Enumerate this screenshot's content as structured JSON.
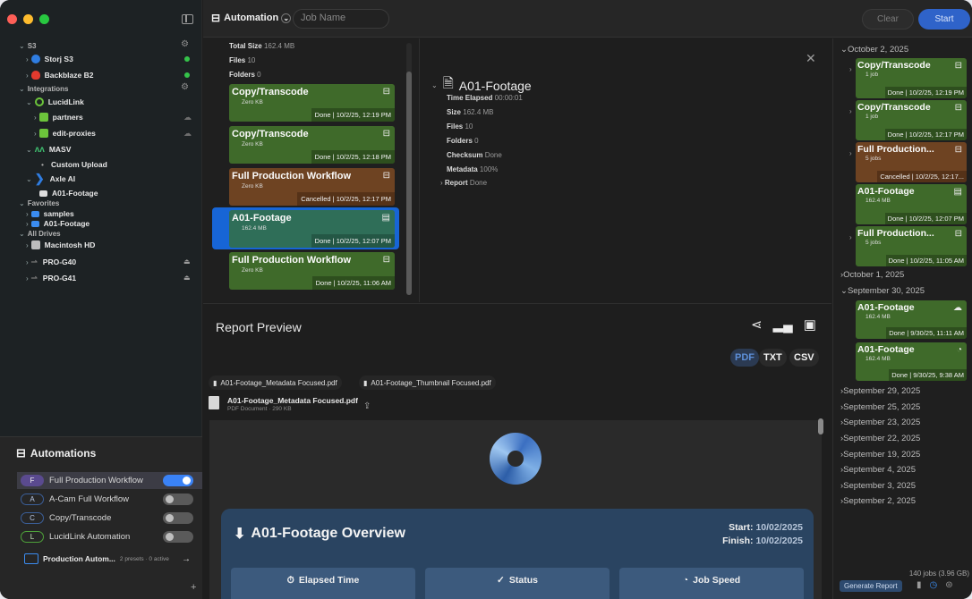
{
  "window": {
    "traffic_lights": [
      "#fe5f57",
      "#febc2e",
      "#28c840"
    ]
  },
  "sidebar": {
    "sections": {
      "s3": "S3",
      "integrations": "Integrations",
      "favorites": "Favorites",
      "all_drives": "All Drives"
    },
    "items": {
      "storj": "Storj S3",
      "backblaze": "Backblaze B2",
      "lucidlink": "LucidLink",
      "partners": "partners",
      "edit_proxies": "edit-proxies",
      "masv": "MASV",
      "custom_upload": "Custom Upload",
      "axle": "Axle AI",
      "axle_footage": "A01-Footage",
      "samples": "samples",
      "fav_footage": "A01-Footage",
      "macintosh": "Macintosh HD",
      "pro_g40": "PRO-G40",
      "pro_g41": "PRO-G41"
    }
  },
  "automations": {
    "title": "Automations",
    "items": [
      {
        "badge": "F",
        "label": "Full Production Workflow",
        "enabled": true
      },
      {
        "badge": "A",
        "label": "A-Cam Full Workflow",
        "enabled": false
      },
      {
        "badge": "C",
        "label": "Copy/Transcode",
        "enabled": false
      },
      {
        "badge": "L",
        "label": "LucidLink Automation",
        "enabled": false
      }
    ],
    "presets_label": "Production Autom...",
    "presets_meta": "2 presets · 0 active",
    "add_symbol": "+"
  },
  "toolbar": {
    "automation_label": "Automation",
    "job_name_placeholder": "Job Name",
    "clear_label": "Clear",
    "start_label": "Start"
  },
  "jobs_panel": {
    "total_size_label": "Total Size",
    "total_size": "162.4 MB",
    "files_label": "Files",
    "files": "10",
    "folders_label": "Folders",
    "folders": "0",
    "cards": [
      {
        "title": "Copy/Transcode",
        "sub": "Zero KB",
        "status": "Done | 10/2/25, 12:19 PM",
        "color": "#3f6a2a",
        "icon": "⊟"
      },
      {
        "title": "Copy/Transcode",
        "sub": "Zero KB",
        "status": "Done | 10/2/25, 12:18 PM",
        "color": "#3f6a2a",
        "icon": "⊟"
      },
      {
        "title": "Full Production Workflow",
        "sub": "Zero KB",
        "status": "Cancelled | 10/2/25, 12:17 PM",
        "color": "#6e4322",
        "icon": "⊟"
      },
      {
        "title": "A01-Footage",
        "sub": "162.4 MB",
        "status": "Done | 10/2/25, 12:07 PM",
        "color": "#2f6e58",
        "icon": "▤",
        "selected": true
      },
      {
        "title": "Full Production Workflow",
        "sub": "Zero KB",
        "status": "Done | 10/2/25, 11:06 AM",
        "color": "#3f6a2a",
        "icon": "⊟"
      }
    ]
  },
  "detail": {
    "title": "A01-Footage",
    "lines": [
      {
        "label": "Time Elapsed",
        "value": "00:00:01"
      },
      {
        "label": "Size",
        "value": "162.4 MB"
      },
      {
        "label": "Files",
        "value": "10"
      },
      {
        "label": "Folders",
        "value": "0"
      },
      {
        "label": "Checksum",
        "value": "Done"
      },
      {
        "label": "Metadata",
        "value": "100%"
      },
      {
        "label": "Report",
        "value": "Done"
      }
    ]
  },
  "report": {
    "title": "Report Preview",
    "formats": [
      "PDF",
      "TXT",
      "CSV"
    ],
    "tabs": [
      "A01-Footage_Metadata Focused.pdf",
      "A01-Footage_Thumbnail Focused.pdf"
    ],
    "doc_name": "A01-Footage_Metadata Focused.pdf",
    "doc_meta": "PDF Document · 290 KB",
    "overview_title": "A01-Footage Overview",
    "start_label": "Start:",
    "start_value": "10/02/2025",
    "finish_label": "Finish:",
    "finish_value": "10/02/2025",
    "stats": [
      "Elapsed Time",
      "Status",
      "Job Speed"
    ]
  },
  "history": {
    "dates": {
      "oct2": "October 2, 2025",
      "oct1": "October 1, 2025",
      "sep30": "September 30, 2025",
      "sep29": "September 29, 2025",
      "sep25": "September 25, 2025",
      "sep23": "September 23, 2025",
      "sep22": "September 22, 2025",
      "sep19": "September 19, 2025",
      "sep4": "September 4, 2025",
      "sep3": "September 3, 2025",
      "sep2": "September 2, 2025"
    },
    "oct2_cards": [
      {
        "title": "Copy/Transcode",
        "sub": "1 job",
        "status": "Done | 10/2/25, 12:19 PM",
        "color": "#3f6a2a",
        "icon": "⊟",
        "chev": true
      },
      {
        "title": "Copy/Transcode",
        "sub": "1 job",
        "status": "Done | 10/2/25, 12:17 PM",
        "color": "#3f6a2a",
        "icon": "⊟",
        "chev": true
      },
      {
        "title": "Full Production...",
        "sub": "5 jobs",
        "status": "Cancelled | 10/2/25, 12:17...",
        "color": "#6e4322",
        "icon": "⊟",
        "chev": true
      },
      {
        "title": "A01-Footage",
        "sub": "162.4 MB",
        "status": "Done | 10/2/25, 12:07 PM",
        "color": "#3f6a2a",
        "icon": "▤",
        "chev": false
      },
      {
        "title": "Full Production...",
        "sub": "5 jobs",
        "status": "Done | 10/2/25, 11:05 AM",
        "color": "#3f6a2a",
        "icon": "⊟",
        "chev": true
      }
    ],
    "sep30_cards": [
      {
        "title": "A01-Footage",
        "sub": "162.4 MB",
        "status": "Done | 9/30/25, 11:11 AM",
        "color": "#3f6a2a",
        "icon": "☁"
      },
      {
        "title": "A01-Footage",
        "sub": "162.4 MB",
        "status": "Done | 9/30/25, 9:38 AM",
        "color": "#3f6a2a",
        "icon": "◔"
      }
    ],
    "job_count": "140 jobs (3.96 GB)",
    "generate_label": "Generate Report"
  }
}
